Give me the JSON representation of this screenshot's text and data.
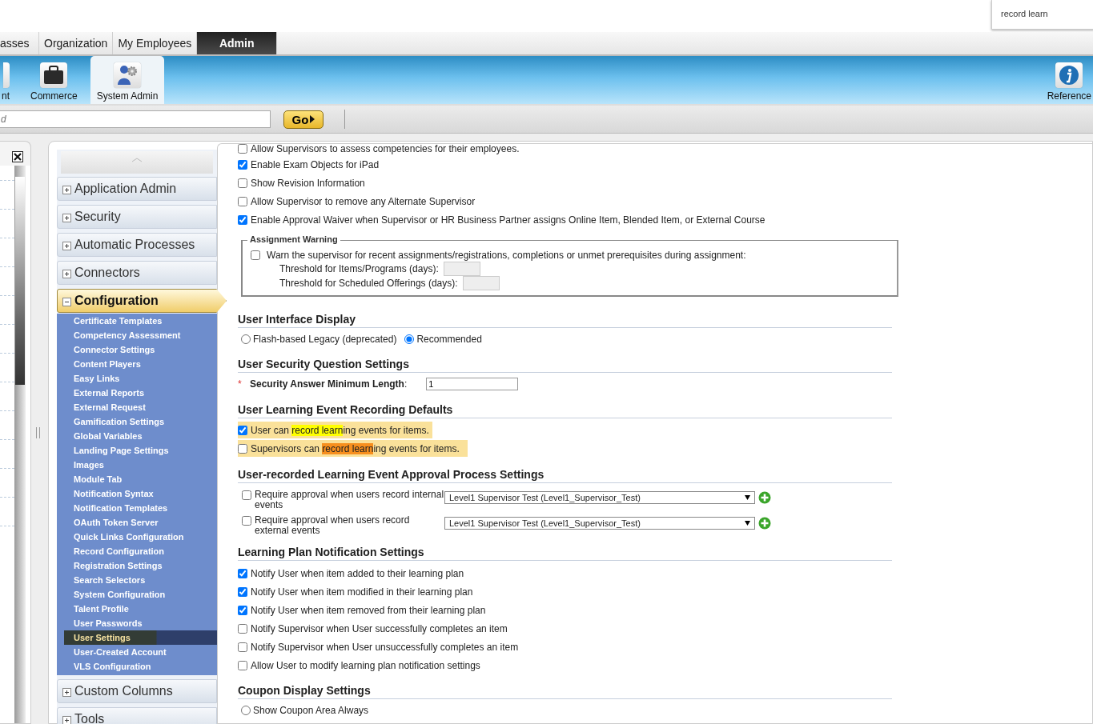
{
  "find_box": {
    "value": "record learn"
  },
  "tabs": [
    {
      "label": "asses",
      "selected": false
    },
    {
      "label": "Organization",
      "selected": false
    },
    {
      "label": "My Employees",
      "selected": false
    },
    {
      "label": "Admin",
      "selected": true
    }
  ],
  "toolbar": {
    "items": [
      {
        "label": "nt",
        "selected": false
      },
      {
        "label": "Commerce",
        "selected": false
      },
      {
        "label": "System Admin",
        "selected": true
      }
    ],
    "right_item": {
      "label": "Reference"
    }
  },
  "search": {
    "placeholder": "d",
    "button": "Go"
  },
  "nav": {
    "groups": [
      {
        "label": "Application Admin",
        "expanded": false
      },
      {
        "label": "Security",
        "expanded": false
      },
      {
        "label": "Automatic Processes",
        "expanded": false
      },
      {
        "label": "Connectors",
        "expanded": false
      },
      {
        "label": "Configuration",
        "expanded": true,
        "children": [
          {
            "label": "Certificate Templates",
            "selected": false
          },
          {
            "label": "Competency Assessment",
            "selected": false
          },
          {
            "label": "Connector Settings",
            "selected": false
          },
          {
            "label": "Content Players",
            "selected": false
          },
          {
            "label": "Easy Links",
            "selected": false
          },
          {
            "label": "External Reports",
            "selected": false
          },
          {
            "label": "External Request",
            "selected": false
          },
          {
            "label": "Gamification Settings",
            "selected": false
          },
          {
            "label": "Global Variables",
            "selected": false
          },
          {
            "label": "Landing Page Settings",
            "selected": false
          },
          {
            "label": "Images",
            "selected": false
          },
          {
            "label": "Module Tab",
            "selected": false
          },
          {
            "label": "Notification Syntax",
            "selected": false
          },
          {
            "label": "Notification Templates",
            "selected": false
          },
          {
            "label": "OAuth Token Server",
            "selected": false
          },
          {
            "label": "Quick Links Configuration",
            "selected": false
          },
          {
            "label": "Record Configuration",
            "selected": false
          },
          {
            "label": "Registration Settings",
            "selected": false
          },
          {
            "label": "Search Selectors",
            "selected": false
          },
          {
            "label": "System Configuration",
            "selected": false
          },
          {
            "label": "Talent Profile",
            "selected": false
          },
          {
            "label": "User Passwords",
            "selected": false
          },
          {
            "label": "User Settings",
            "selected": true
          },
          {
            "label": "User-Created Account",
            "selected": false
          },
          {
            "label": "VLS Configuration",
            "selected": false
          }
        ]
      },
      {
        "label": "Custom Columns",
        "expanded": false
      },
      {
        "label": "Tools",
        "expanded": false
      }
    ]
  },
  "sections": [
    {
      "kind": "checks",
      "items": [
        {
          "label": "Allow Supervisors to assess competencies for their employees.",
          "checked": false
        },
        {
          "label": "Enable Exam Objects for iPad",
          "checked": true
        },
        {
          "label": "Show Revision Information",
          "checked": false
        },
        {
          "label": "Allow Supervisor to remove any Alternate Supervisor",
          "checked": false
        },
        {
          "label": "Enable Approval Waiver when Supervisor or HR Business Partner assigns Online Item, Blended Item, or External Course",
          "checked": true
        }
      ]
    },
    {
      "kind": "fieldset",
      "legend": "Assignment Warning",
      "check": {
        "label": "Warn the supervisor for recent assignments/registrations, completions or unmet prerequisites during assignment:",
        "checked": false
      },
      "fields": [
        {
          "label": "Threshold for Items/Programs (days):"
        },
        {
          "label": "Threshold for Scheduled Offerings (days):"
        }
      ]
    },
    {
      "kind": "radios",
      "heading": "User Interface Display",
      "options": [
        {
          "label": "Flash-based Legacy (deprecated)",
          "selected": false
        },
        {
          "label": "Recommended",
          "selected": true
        }
      ]
    },
    {
      "kind": "field",
      "heading": "User Security Question Settings",
      "required_mark": "*",
      "label": "**Security Answer Minimum Length**:",
      "value": "1"
    },
    {
      "kind": "highlights",
      "heading": "User Learning Event Recording Defaults",
      "items": [
        {
          "before": "User can ",
          "match": "record learn",
          "after": "ing events for items.",
          "checked": true,
          "current": false
        },
        {
          "before": "Supervisors can ",
          "match": "record learn",
          "after": "ing events for items.",
          "checked": false,
          "current": true
        }
      ]
    },
    {
      "kind": "approvals",
      "heading": "User-recorded Learning Event Approval Process Settings",
      "items": [
        {
          "label": "Require approval when users record internal events",
          "checked": false,
          "value": "Level1 Supervisor Test (Level1_Supervisor_Test)"
        },
        {
          "label": "Require approval when users record external events",
          "checked": false,
          "value": "Level1 Supervisor Test (Level1_Supervisor_Test)"
        }
      ]
    },
    {
      "kind": "checks",
      "heading": "Learning Plan Notification Settings",
      "items": [
        {
          "label": "Notify User when item added to their learning plan",
          "checked": true
        },
        {
          "label": "Notify User when item modified in their learning plan",
          "checked": true
        },
        {
          "label": "Notify User when item removed from their learning plan",
          "checked": true
        },
        {
          "label": "Notify Supervisor when User successfully completes an item",
          "checked": false
        },
        {
          "label": "Notify Supervisor when User unsuccessfully completes an item",
          "checked": false
        },
        {
          "label": "Allow User to modify learning plan notification settings",
          "checked": false
        }
      ]
    },
    {
      "kind": "radios",
      "heading": "Coupon Display Settings",
      "options": [
        {
          "label": "Show Coupon Area Always",
          "selected": false
        }
      ]
    }
  ]
}
